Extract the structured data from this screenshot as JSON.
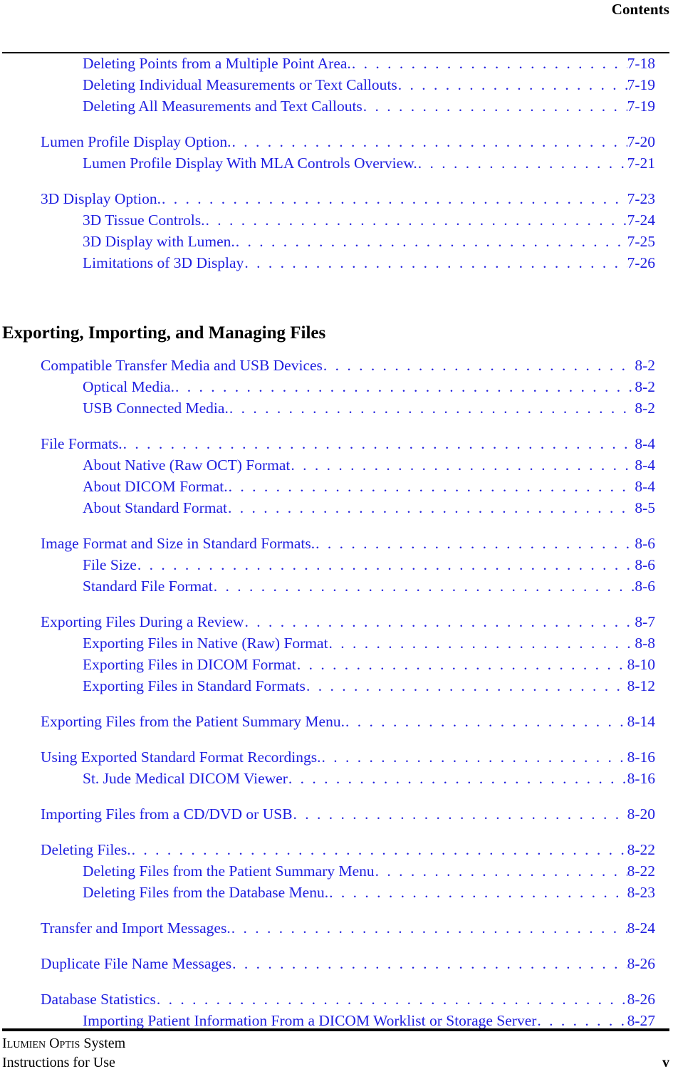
{
  "header": {
    "title": "Contents"
  },
  "toc": {
    "groups": [
      {
        "gap": "none",
        "entries": [
          {
            "level": 2,
            "label": "Deleting Points from a Multiple Point Area.",
            "page": "7-18"
          },
          {
            "level": 2,
            "label": "Deleting Individual Measurements or Text Callouts",
            "page": "7-19"
          },
          {
            "level": 2,
            "label": "Deleting All Measurements and Text Callouts ",
            "page": "7-19"
          }
        ]
      },
      {
        "gap": "sm",
        "entries": [
          {
            "level": 1,
            "label": "Lumen Profile Display Option.",
            "page": "7-20"
          },
          {
            "level": 2,
            "label": "Lumen Profile Display With MLA Controls Overview.",
            "page": "7-21"
          }
        ]
      },
      {
        "gap": "sm",
        "entries": [
          {
            "level": 1,
            "label": "3D Display Option.",
            "page": "7-23"
          },
          {
            "level": 2,
            "label": "3D Tissue Controls.",
            "page": "7-24"
          },
          {
            "level": 2,
            "label": "3D Display with Lumen.",
            "page": "7-25"
          },
          {
            "level": 2,
            "label": "Limitations of 3D Display ",
            "page": "7-26"
          }
        ]
      }
    ]
  },
  "chapter": {
    "heading": "Exporting, Importing, and Managing Files",
    "groups": [
      {
        "gap": "none",
        "entries": [
          {
            "level": 1,
            "label": "Compatible Transfer Media and USB Devices ",
            "page": "8-2"
          },
          {
            "level": 2,
            "label": "Optical Media.",
            "page": "8-2"
          },
          {
            "level": 2,
            "label": "USB Connected Media.",
            "page": "8-2"
          }
        ]
      },
      {
        "gap": "sm",
        "entries": [
          {
            "level": 1,
            "label": "File Formats.",
            "page": "8-4"
          },
          {
            "level": 2,
            "label": "About Native (Raw OCT) Format ",
            "page": "8-4"
          },
          {
            "level": 2,
            "label": "About DICOM Format.",
            "page": "8-4"
          },
          {
            "level": 2,
            "label": "About Standard Format ",
            "page": "8-5"
          }
        ]
      },
      {
        "gap": "sm",
        "entries": [
          {
            "level": 1,
            "label": "Image Format and Size in Standard Formats.",
            "page": "8-6"
          },
          {
            "level": 2,
            "label": "File Size ",
            "page": "8-6"
          },
          {
            "level": 2,
            "label": "Standard File Format ",
            "page": "8-6"
          }
        ]
      },
      {
        "gap": "sm",
        "entries": [
          {
            "level": 1,
            "label": "Exporting Files During a Review ",
            "page": "8-7"
          },
          {
            "level": 2,
            "label": "Exporting Files in Native (Raw) Format ",
            "page": "8-8"
          },
          {
            "level": 2,
            "label": "Exporting Files in DICOM Format ",
            "page": "8-10"
          },
          {
            "level": 2,
            "label": "Exporting Files in Standard Formats ",
            "page": "8-12"
          }
        ]
      },
      {
        "gap": "sm",
        "entries": [
          {
            "level": 1,
            "label": "Exporting Files from the Patient Summary Menu.",
            "page": "8-14"
          }
        ]
      },
      {
        "gap": "sm",
        "entries": [
          {
            "level": 1,
            "label": "Using Exported Standard Format Recordings.",
            "page": "8-16"
          },
          {
            "level": 2,
            "label": "St. Jude Medical DICOM Viewer ",
            "page": "8-16"
          }
        ]
      },
      {
        "gap": "sm",
        "entries": [
          {
            "level": 1,
            "label": "Importing Files from a CD/DVD or USB ",
            "page": "8-20"
          }
        ]
      },
      {
        "gap": "sm",
        "entries": [
          {
            "level": 1,
            "label": "Deleting Files.",
            "page": "8-22"
          },
          {
            "level": 2,
            "label": "Deleting Files from the Patient Summary Menu ",
            "page": "8-22"
          },
          {
            "level": 2,
            "label": "Deleting Files from the Database Menu.",
            "page": "8-23"
          }
        ]
      },
      {
        "gap": "sm",
        "entries": [
          {
            "level": 1,
            "label": "Transfer and Import Messages.",
            "page": "8-24"
          }
        ]
      },
      {
        "gap": "sm",
        "entries": [
          {
            "level": 1,
            "label": "Duplicate File Name Messages ",
            "page": "8-26"
          }
        ]
      },
      {
        "gap": "sm",
        "entries": [
          {
            "level": 1,
            "label": "Database Statistics ",
            "page": "8-26"
          },
          {
            "level": 2,
            "label": "Importing Patient Information From a DICOM Worklist or Storage Server ",
            "page": "8-27"
          }
        ]
      }
    ]
  },
  "footer": {
    "line1_part1": "Ilumien",
    "line1_part2": "Optis",
    "line1_part3": "System",
    "line2": "Instructions for Use",
    "page": "v"
  },
  "colors": {
    "link": "#2020e0",
    "text": "#000000",
    "rule": "#000000"
  }
}
